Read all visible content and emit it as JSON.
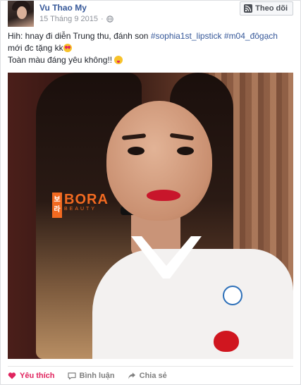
{
  "post": {
    "author": "Vu Thao My",
    "date": "15 Tháng 9 2015",
    "follow_label": "Theo dõi",
    "text_line1_prefix": "Hih: hnay đi diễn Trung thu, đánh son ",
    "hashtag1": "#sophia1st_lipstick",
    "hashtag2": "#m04_đôgạch",
    "text_line2": "mới đc tặng kk",
    "text_line3": "Toàn màu đáng yêu không!! "
  },
  "photo": {
    "watermark_box_top": "보",
    "watermark_box_bottom": "라",
    "watermark_text": "BORA",
    "watermark_sub": "BEAUTY"
  },
  "actions": {
    "like_label": "Yêu thích",
    "comment_label": "Bình luận",
    "share_label": "Chia sẻ"
  },
  "colors": {
    "link": "#365899",
    "like": "#e0245e",
    "watermark": "#f26a21"
  }
}
